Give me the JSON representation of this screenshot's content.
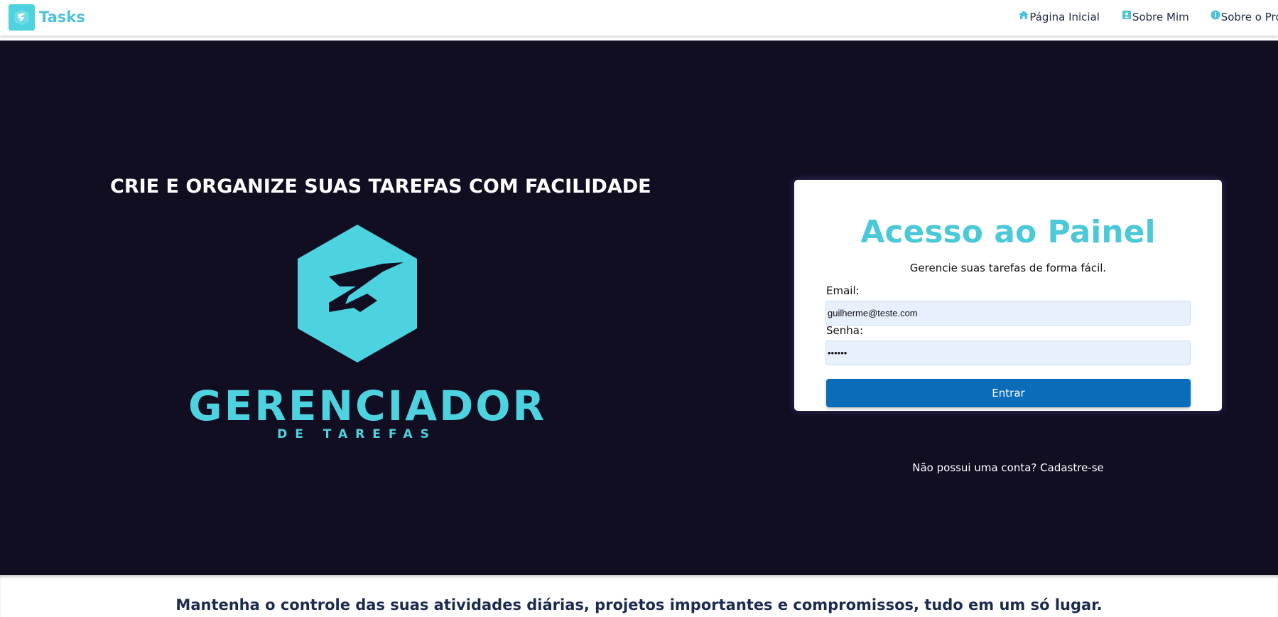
{
  "header": {
    "brand": "Tasks",
    "brand_icon": "z-hexagon-logo-icon",
    "nav": [
      {
        "label": "Página Inicial",
        "icon": "home-icon"
      },
      {
        "label": "Sobre Mim",
        "icon": "user-card-icon"
      },
      {
        "label": "Sobre o Projeto",
        "icon": "info-icon"
      }
    ]
  },
  "hero": {
    "title": "CRIE E ORGANIZE SUAS TAREFAS COM FACILIDADE",
    "logo_word": "GERENCIADOR",
    "logo_sub": "DE TAREFAS"
  },
  "login": {
    "title": "Acesso ao Painel",
    "subtitle": "Gerencie suas tarefas de forma fácil.",
    "email_label": "Email:",
    "email_value": "guilherme@teste.com",
    "password_label": "Senha:",
    "password_value": "123456",
    "submit_label": "Entrar",
    "signup_link": "Não possui uma conta? Cadastre-se"
  },
  "footer": {
    "tagline": "Mantenha o controle das suas atividades diárias, projetos importantes e compromissos, tudo em um só lugar."
  },
  "colors": {
    "accent": "#4dd2e0",
    "hero_bg": "#120e22",
    "button": "#0b6db9",
    "nav_text": "#1e2a44"
  }
}
